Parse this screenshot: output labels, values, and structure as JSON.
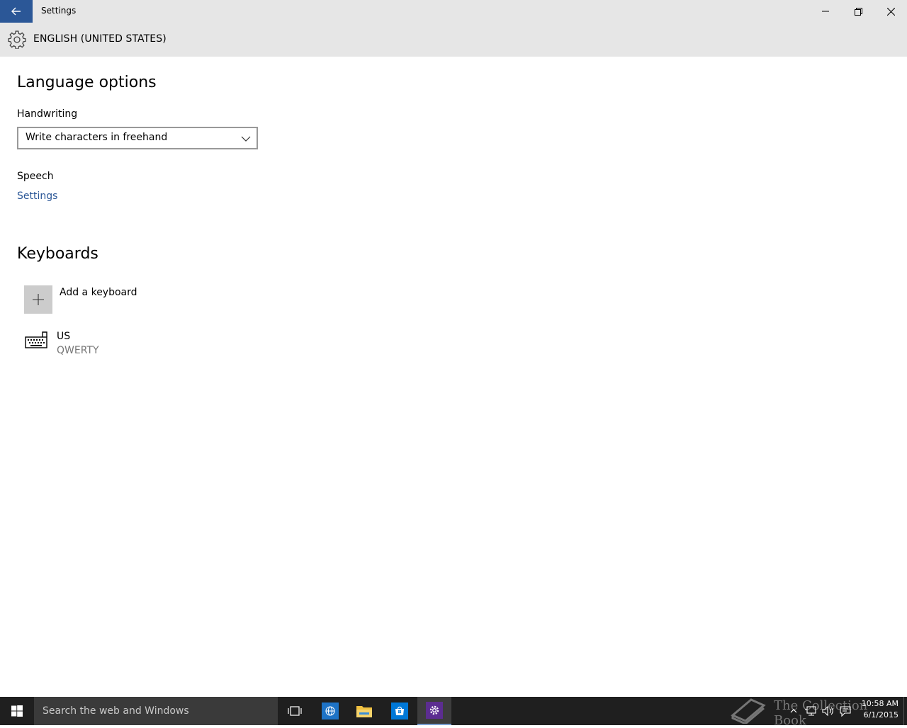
{
  "window": {
    "title": "Settings"
  },
  "header": {
    "title": "ENGLISH (UNITED STATES)"
  },
  "language_options": {
    "heading": "Language options",
    "handwriting_label": "Handwriting",
    "handwriting_value": "Write characters in freehand",
    "speech_label": "Speech",
    "speech_link": "Settings"
  },
  "keyboards": {
    "heading": "Keyboards",
    "add_label": "Add a keyboard",
    "items": [
      {
        "name": "US",
        "layout": "QWERTY"
      }
    ]
  },
  "taskbar": {
    "search_placeholder": "Search the web and Windows",
    "apps": [
      "task-view",
      "internet-explorer",
      "file-explorer",
      "store",
      "settings"
    ],
    "active_app": "settings"
  },
  "watermark": {
    "text": "The Collection Book"
  },
  "clock": {
    "time": "10:58 AM",
    "date": "6/1/2015"
  },
  "colors": {
    "accent": "#2b5797",
    "chrome": "#e6e6e6",
    "taskbar": "#1f1f1f",
    "settings_tile": "#5c2d91",
    "store_tile": "#0078d7",
    "ie_tile": "#1e73c6",
    "explorer_tile": "#f0c040"
  }
}
